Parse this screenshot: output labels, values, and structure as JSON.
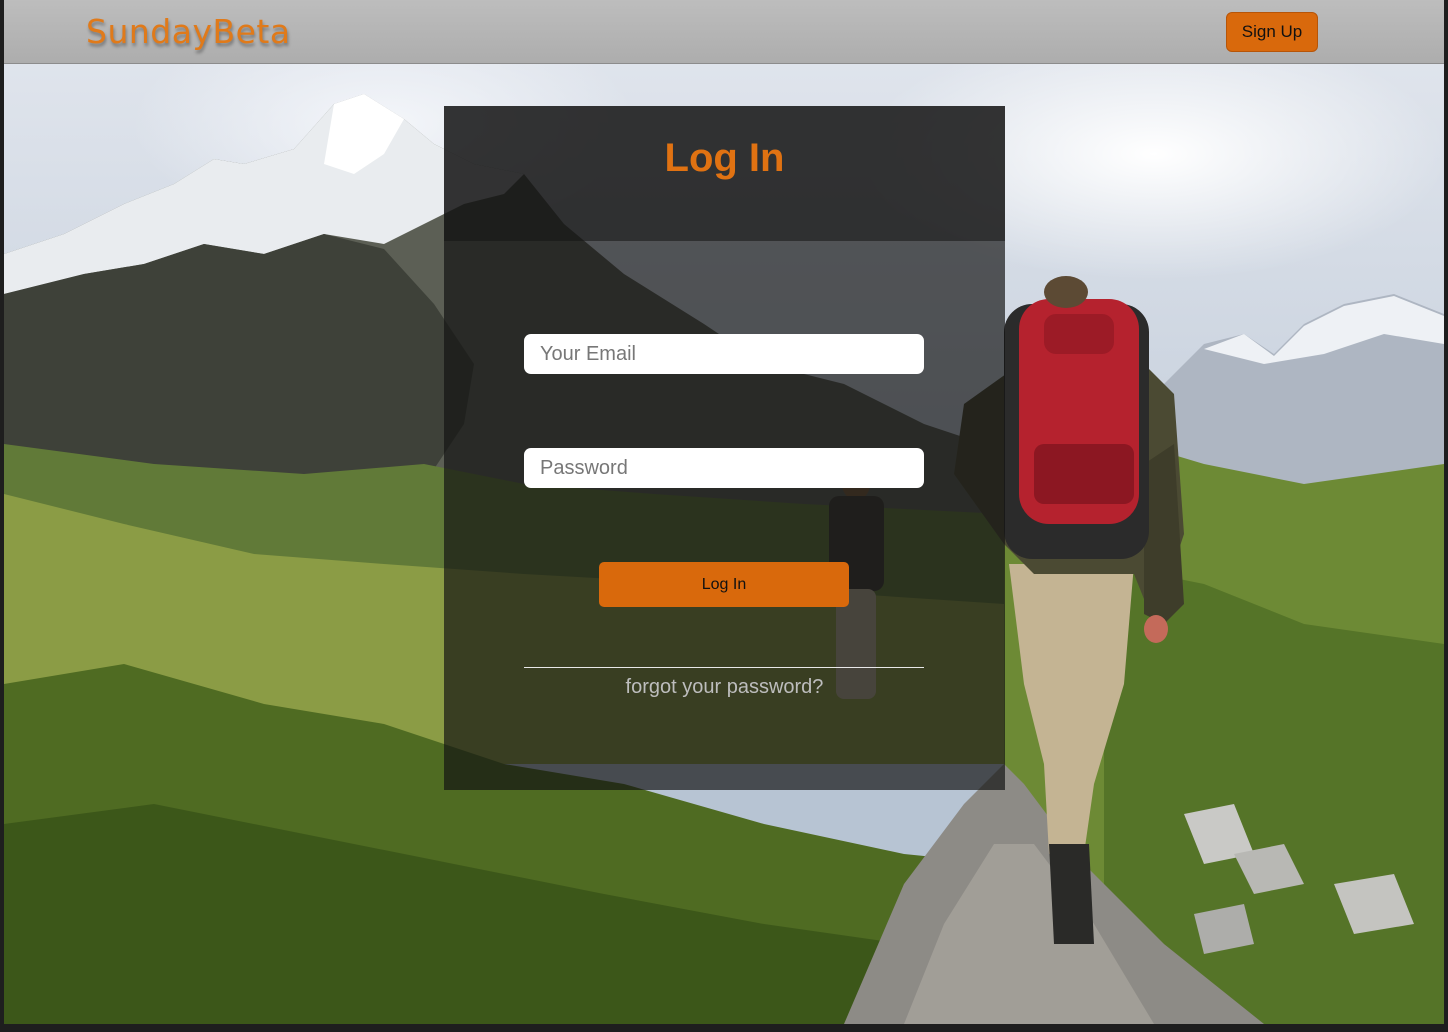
{
  "navbar": {
    "brand": "SundayBeta",
    "signup_label": "Sign Up"
  },
  "login": {
    "title": "Log In",
    "email_placeholder": "Your Email",
    "password_placeholder": "Password",
    "submit_label": "Log In",
    "forgot_label": "forgot your password?"
  },
  "colors": {
    "accent": "#d9690c",
    "title": "#e07212",
    "navbar": "#b3b3b3"
  },
  "background": {
    "description_icon": "mountain-hiker-photo"
  }
}
